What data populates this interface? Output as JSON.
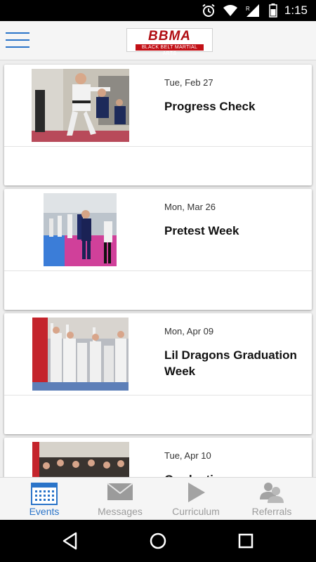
{
  "status_bar": {
    "time": "1:15",
    "icons": [
      "alarm-icon",
      "wifi-icon",
      "signal-icon",
      "roaming-icon",
      "battery-icon"
    ]
  },
  "header": {
    "logo_text": "BBMA",
    "logo_subtitle": "BLACK BELT MARTIAL ARTS",
    "menu_icon": "hamburger-menu-icon"
  },
  "events": [
    {
      "date": "Tue, Feb 27",
      "title": "Progress Check",
      "photo": "event-photo-progress-check"
    },
    {
      "date": "Mon, Mar 26",
      "title": "Pretest Week",
      "photo": "event-photo-pretest-week"
    },
    {
      "date": "Mon, Apr 09",
      "title": "Lil Dragons Graduation Week",
      "photo": "event-photo-lil-dragons"
    },
    {
      "date": "Tue, Apr 10",
      "title": "Graduation",
      "photo": "event-photo-graduation"
    }
  ],
  "tabs": [
    {
      "label": "Events",
      "icon": "calendar-icon",
      "active": true
    },
    {
      "label": "Messages",
      "icon": "envelope-icon",
      "active": false
    },
    {
      "label": "Curriculum",
      "icon": "play-icon",
      "active": false
    },
    {
      "label": "Referrals",
      "icon": "people-icon",
      "active": false
    }
  ],
  "colors": {
    "accent": "#2a74c9",
    "inactive_tab": "#9b9b9b",
    "logo_red": "#b00d12"
  }
}
